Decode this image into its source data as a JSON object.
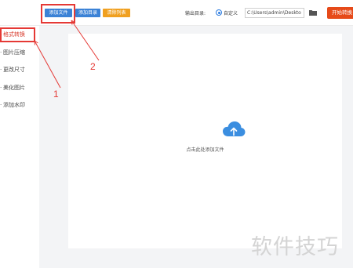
{
  "toolbar": {
    "add_file_label": "添加文件",
    "add_dir_label": "添加目录",
    "clear_list_label": "清除列表",
    "output_dir_label": "输出目录:",
    "custom_option_label": "自定义",
    "path_value": "C:\\Users\\admin\\Deskto",
    "start_label": "开始转换"
  },
  "sidebar": {
    "items": [
      {
        "label": "格式转换",
        "active": true
      },
      {
        "label": "图片压缩"
      },
      {
        "label": "更改尺寸"
      },
      {
        "label": "美化图片"
      },
      {
        "label": "添加水印"
      }
    ]
  },
  "main": {
    "drop_hint": "点击此处添加文件"
  },
  "annotations": {
    "step_1": "1",
    "step_2": "2"
  },
  "watermark": "软件技巧",
  "icons": {
    "folder": "folder-icon",
    "cloud_upload": "cloud-upload-icon"
  },
  "colors": {
    "primary_button": "#3b82d6",
    "clear_button": "#f0a020",
    "start_button": "#e64a19",
    "annotation": "#e53935",
    "cloud_icon": "#3b8ee0",
    "active_item": "#d83a2b"
  }
}
